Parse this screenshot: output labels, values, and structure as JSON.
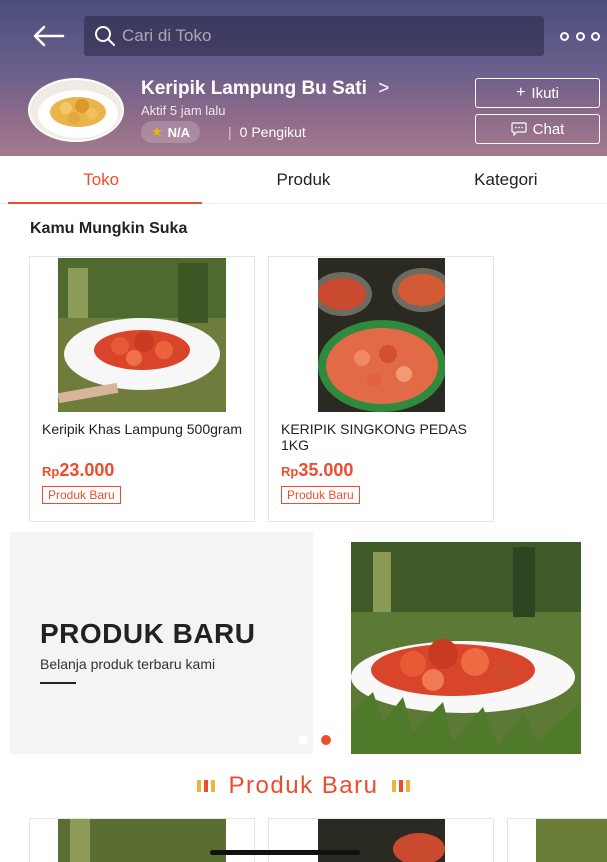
{
  "header": {
    "search_placeholder": "Cari di Toko",
    "shop_name": "Keripik Lampung Bu Sati",
    "shop_name_chevron": ">",
    "active_status": "Aktif 5 jam lalu",
    "rating": "N/A",
    "followers": "0 Pengikut",
    "follow_label": "Ikuti",
    "chat_label": "Chat",
    "gradient_colors": [
      "#4b4e7c",
      "#a57a8c"
    ]
  },
  "tabs": [
    {
      "label": "Toko",
      "active": true
    },
    {
      "label": "Produk",
      "active": false
    },
    {
      "label": "Kategori",
      "active": false
    }
  ],
  "recommend": {
    "title": "Kamu Mungkin Suka",
    "products": [
      {
        "name": "Keripik Khas Lampung 500gram",
        "currency": "Rp",
        "price": "23.000",
        "tag": "Produk Baru"
      },
      {
        "name": "KERIPIK SINGKONG PEDAS 1KG",
        "currency": "Rp",
        "price": "35.000",
        "tag": "Produk Baru"
      }
    ]
  },
  "banner": {
    "title": "PRODUK BARU",
    "subtitle": "Belanja produk terbaru kami",
    "active_slide": 2,
    "slides": 2
  },
  "new_products": {
    "title": "Produk Baru"
  },
  "colors": {
    "accent": "#ee4d2d",
    "star": "#f5b400"
  }
}
